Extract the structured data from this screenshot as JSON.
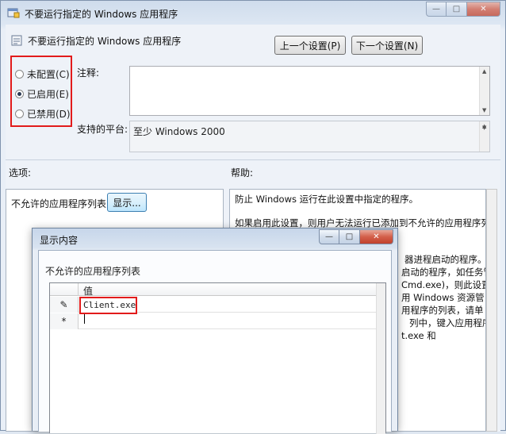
{
  "window": {
    "title": "不要运行指定的 Windows 应用程序",
    "caption_minimize": "—",
    "caption_maximize": "□",
    "caption_close": "✕"
  },
  "policy": {
    "header": "不要运行指定的 Windows 应用程序",
    "prev_button": "上一个设置(P)",
    "next_button": "下一个设置(N)",
    "radio_options": [
      {
        "label": "未配置(C)",
        "checked": false
      },
      {
        "label": "已启用(E)",
        "checked": true
      },
      {
        "label": "已禁用(D)",
        "checked": false
      }
    ],
    "comment_label": "注释:",
    "comment_value": "",
    "platform_label": "支持的平台:",
    "platform_value": "至少 Windows 2000"
  },
  "options": {
    "heading": "选项:",
    "list_label": "不允许的应用程序列表",
    "show_button": "显示..."
  },
  "help": {
    "heading": "帮助:",
    "lines": [
      "防止 Windows 运行在此设置中指定的程序。",
      "如果启用此设置，则用户无法运行已添加到不允许的应用程序列表",
      "器进程启动的程序。",
      "启动的程序，如任务管",
      "Cmd.exe)，则此设置",
      "用 Windows 资源管",
      "用程序的列表，请单",
      "列中，键入应用程序",
      "t.exe 和"
    ]
  },
  "dialog": {
    "title": "显示内容",
    "list_label": "不允许的应用程序列表",
    "column_header": "值",
    "rows": [
      {
        "marker": "✎",
        "value": "Client.exe",
        "editing": true
      },
      {
        "marker": "*",
        "value": "",
        "editing": false
      }
    ]
  },
  "colors": {
    "highlight": "#e21b1b",
    "window_frame": "#cfdcec"
  }
}
